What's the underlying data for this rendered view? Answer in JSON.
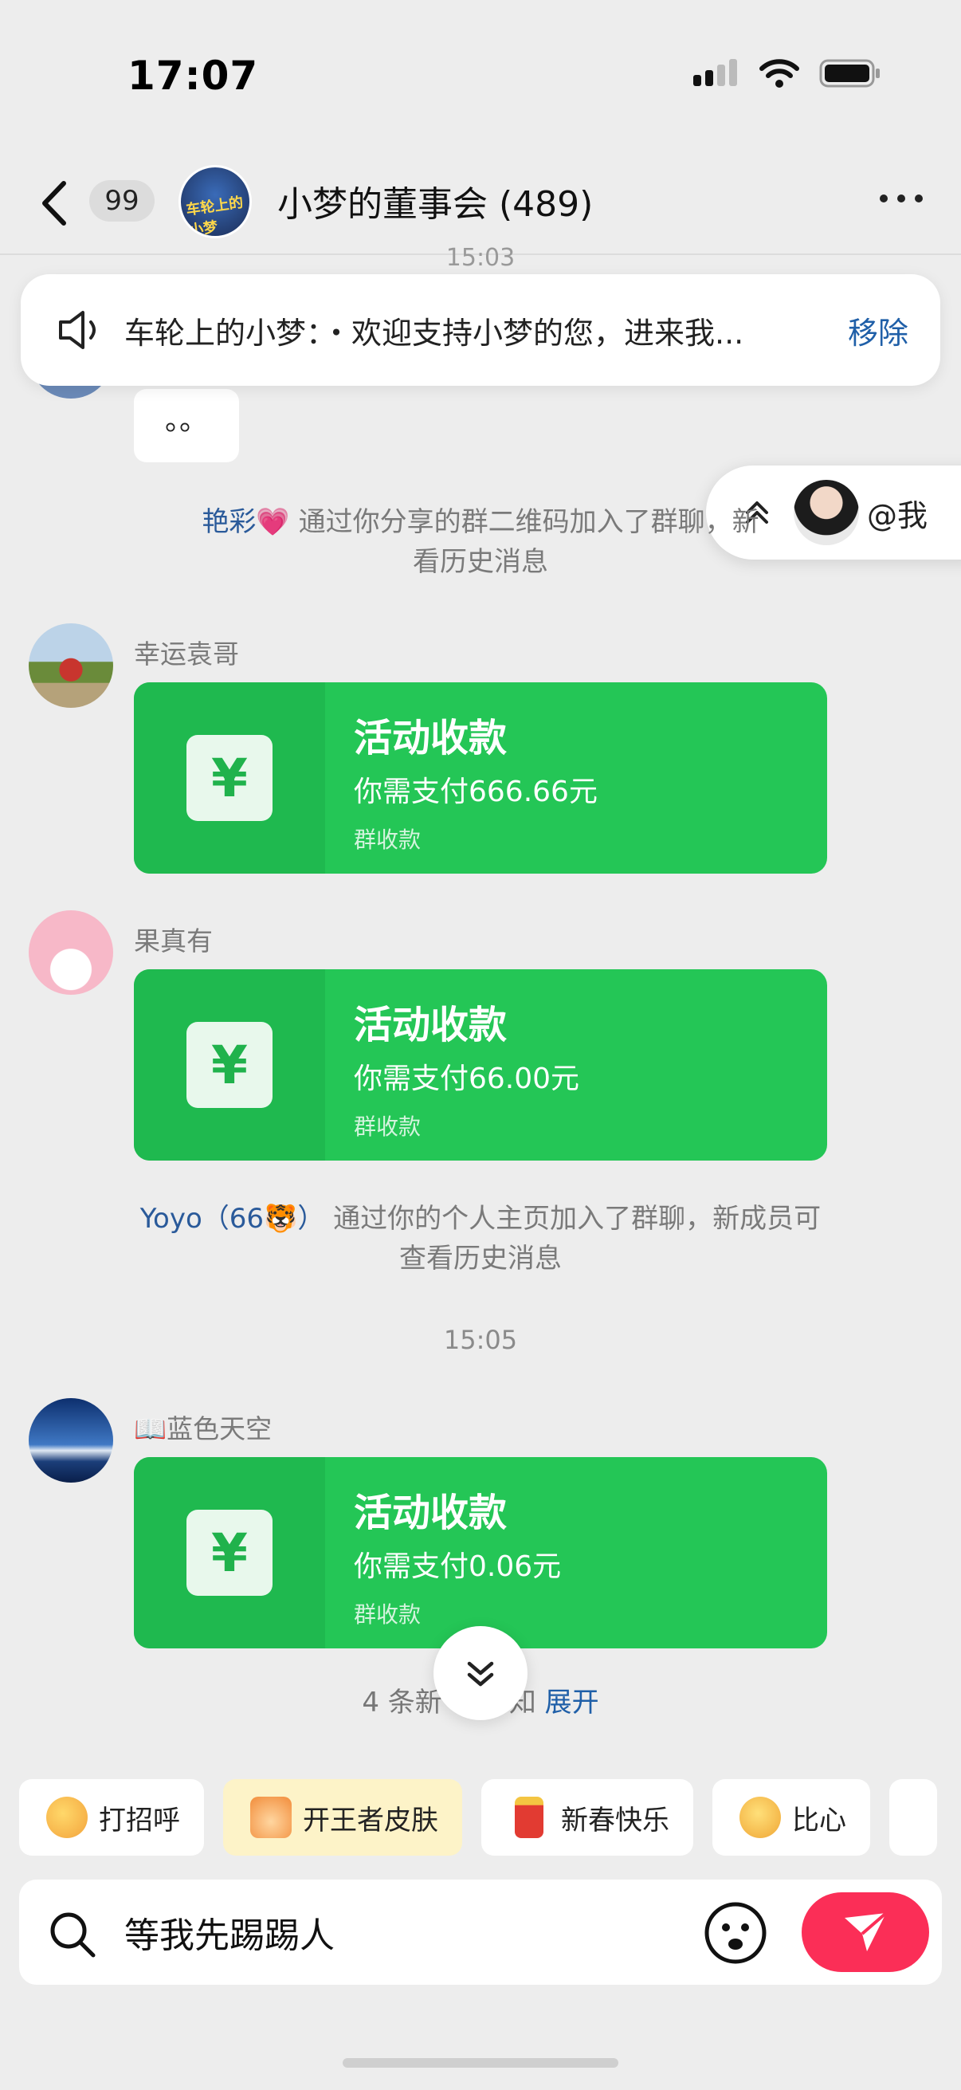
{
  "status_bar": {
    "time": "17:07"
  },
  "header": {
    "unread_badge": "99",
    "group_avatar_text": "车轮上的小梦",
    "title": "小梦的董事会 (489)"
  },
  "announcement": {
    "text": "车轮上的小梦：・欢迎支持小梦的您，进来我...",
    "remove_label": "移除"
  },
  "faded_time": "15:03",
  "previous_bubble_text": "。。",
  "at_me": {
    "label": "@我"
  },
  "messages": [
    {
      "type": "system",
      "name": "艳彩💗",
      "line1": " 通过你分享的群二维码加入了群聊，新",
      "line2": "看历史消息"
    },
    {
      "type": "payment",
      "sender": "幸运袁哥",
      "title": "活动收款",
      "amount": "你需支付666.66元",
      "sub": "群收款"
    },
    {
      "type": "payment",
      "sender": "果真有",
      "title": "活动收款",
      "amount": "你需支付66.00元",
      "sub": "群收款"
    },
    {
      "type": "system",
      "name": "Yoyo（66🐯）",
      "line1": " 通过你的个人主页加入了群聊，新成员可",
      "line2": "查看历史消息"
    },
    {
      "type": "time",
      "text": "15:05"
    },
    {
      "type": "payment",
      "sender": "📖蓝色天空",
      "title": "活动收款",
      "amount": "你需支付0.06元",
      "sub": "群收款"
    }
  ],
  "new_notice": {
    "text": "4 条新",
    "text2": "知 ",
    "expand": "展开"
  },
  "quick_chips": [
    {
      "label": "打招呼",
      "icon": "wave-emoji-icon",
      "color": "#f6b24a"
    },
    {
      "label": "开王者皮肤",
      "icon": "cat-emoji-icon",
      "color": "#f59a4b"
    },
    {
      "label": "新春快乐",
      "icon": "firecracker-icon",
      "color": "#e8413a"
    },
    {
      "label": "比心",
      "icon": "heart-hand-emoji-icon",
      "color": "#f5b93a"
    }
  ],
  "input": {
    "value": "等我先踢踢人"
  },
  "colors": {
    "payment_green": "#24c656",
    "send_red": "#fb2e57",
    "link_blue": "#1f5fa8",
    "background": "#ededed"
  }
}
